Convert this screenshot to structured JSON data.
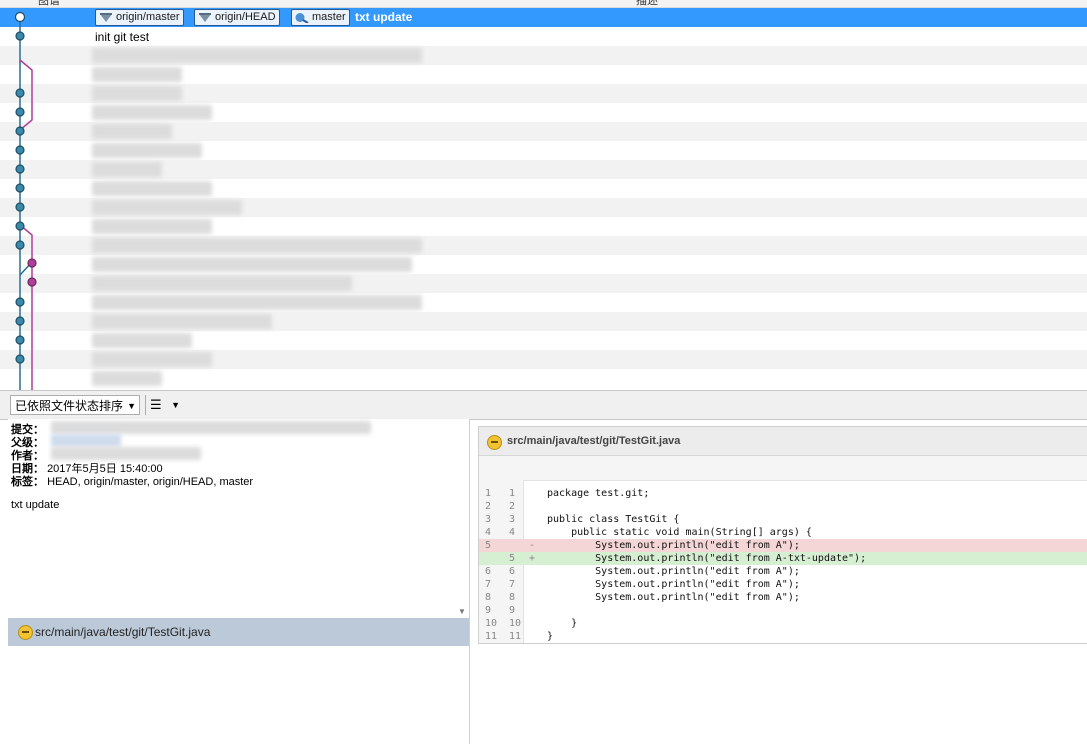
{
  "commit_list": {
    "columns": {
      "graph": "图谱",
      "description": "描述"
    },
    "selected_commit": {
      "tags": [
        "origin/master",
        "origin/HEAD",
        "master"
      ],
      "message": "txt update"
    },
    "second_commit_message": "init git test"
  },
  "toolbar": {
    "sort_label": "已依照文件状态排序",
    "view_icon": "list-icon"
  },
  "detail": {
    "fields": [
      {
        "label": "提交：",
        "value": ""
      },
      {
        "label": "父级：",
        "value": ""
      },
      {
        "label": "作者：",
        "value": ""
      },
      {
        "label": "日期：",
        "value": "2017年5月5日 15:40:00"
      },
      {
        "label": "标签：",
        "value": "HEAD, origin/master, origin/HEAD, master"
      }
    ],
    "message": "txt update"
  },
  "files": [
    {
      "path": "src/main/java/test/git/TestGit.java",
      "status": "modified"
    }
  ],
  "diff": {
    "file": "src/main/java/test/git/TestGit.java",
    "lines": [
      {
        "old": "1",
        "new": "1",
        "type": "ctx",
        "text": "package test.git;"
      },
      {
        "old": "2",
        "new": "2",
        "type": "ctx",
        "text": ""
      },
      {
        "old": "3",
        "new": "3",
        "type": "ctx",
        "text": "public class TestGit {"
      },
      {
        "old": "4",
        "new": "4",
        "type": "ctx",
        "text": "    public static void main(String[] args) {"
      },
      {
        "old": "5",
        "new": "",
        "type": "del",
        "text": "        System.out.println(\"edit from A\");"
      },
      {
        "old": "",
        "new": "5",
        "type": "add",
        "text": "        System.out.println(\"edit from A-txt-update\");"
      },
      {
        "old": "6",
        "new": "6",
        "type": "ctx",
        "text": "        System.out.println(\"edit from A\");"
      },
      {
        "old": "7",
        "new": "7",
        "type": "ctx",
        "text": "        System.out.println(\"edit from A\");"
      },
      {
        "old": "8",
        "new": "8",
        "type": "ctx",
        "text": "        System.out.println(\"edit from A\");"
      },
      {
        "old": "9",
        "new": "9",
        "type": "ctx",
        "text": ""
      },
      {
        "old": "10",
        "new": "10",
        "type": "ctx",
        "text": "    }"
      },
      {
        "old": "11",
        "new": "11",
        "type": "ctx",
        "text": "}"
      }
    ]
  },
  "colors": {
    "selection": "#3399ff",
    "graph_main": "#2a6f8f",
    "graph_branch": "#b03f98",
    "diff_del": "#f5d6d6",
    "diff_add": "#d6efd2"
  }
}
